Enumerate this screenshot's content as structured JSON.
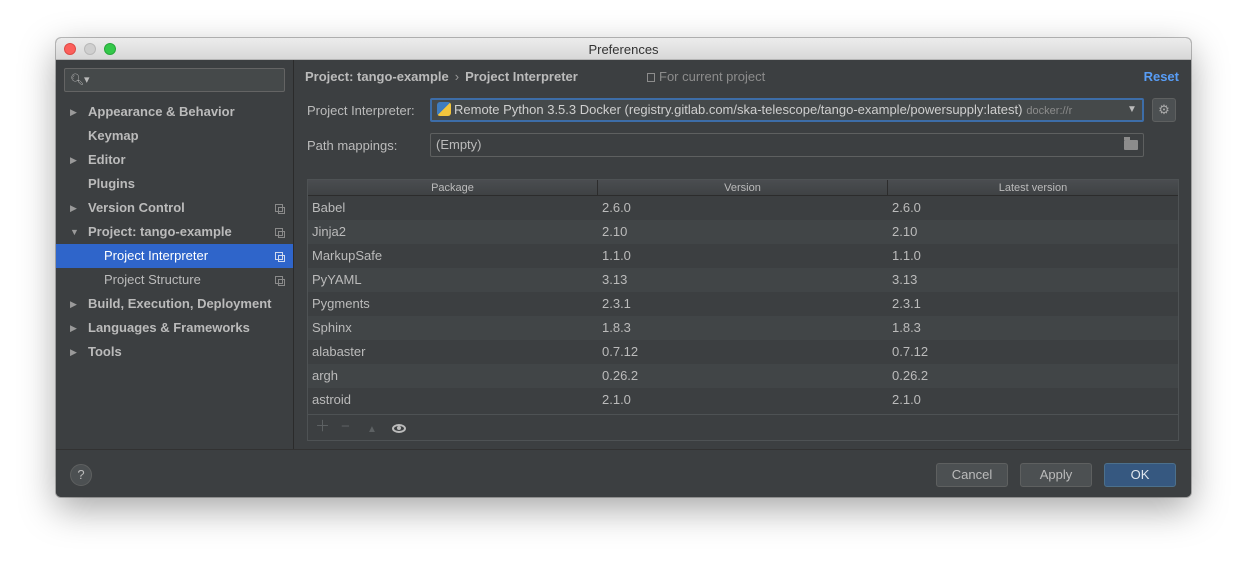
{
  "window": {
    "title": "Preferences"
  },
  "search": {
    "placeholder": ""
  },
  "sidebar": {
    "items": [
      {
        "label": "Appearance & Behavior",
        "expandable": true,
        "expanded": false
      },
      {
        "label": "Keymap",
        "expandable": false
      },
      {
        "label": "Editor",
        "expandable": true,
        "expanded": false
      },
      {
        "label": "Plugins",
        "expandable": false
      },
      {
        "label": "Version Control",
        "expandable": true,
        "expanded": false,
        "project_scoped": true
      },
      {
        "label": "Project: tango-example",
        "expandable": true,
        "expanded": true,
        "project_scoped": true
      },
      {
        "label": "Project Interpreter",
        "child": true,
        "selected": true,
        "project_scoped": true
      },
      {
        "label": "Project Structure",
        "child": true,
        "project_scoped": true
      },
      {
        "label": "Build, Execution, Deployment",
        "expandable": true,
        "expanded": false
      },
      {
        "label": "Languages & Frameworks",
        "expandable": true,
        "expanded": false
      },
      {
        "label": "Tools",
        "expandable": true,
        "expanded": false
      }
    ]
  },
  "header": {
    "crumb_parent": "Project: tango-example",
    "crumb_separator": "›",
    "crumb_current": "Project Interpreter",
    "scope_note": "For current project",
    "reset_label": "Reset"
  },
  "interpreter": {
    "label": "Project Interpreter:",
    "value": "Remote Python 3.5.3 Docker (registry.gitlab.com/ska-telescope/tango-example/powersupply:latest)",
    "hint": "docker://r"
  },
  "path_mappings": {
    "label": "Path mappings:",
    "value": "(Empty)"
  },
  "packages": {
    "columns": [
      "Package",
      "Version",
      "Latest version"
    ],
    "rows": [
      {
        "package": "Babel",
        "version": "2.6.0",
        "latest": "2.6.0"
      },
      {
        "package": "Jinja2",
        "version": "2.10",
        "latest": "2.10"
      },
      {
        "package": "MarkupSafe",
        "version": "1.1.0",
        "latest": "1.1.0"
      },
      {
        "package": "PyYAML",
        "version": "3.13",
        "latest": "3.13"
      },
      {
        "package": "Pygments",
        "version": "2.3.1",
        "latest": "2.3.1"
      },
      {
        "package": "Sphinx",
        "version": "1.8.3",
        "latest": "1.8.3"
      },
      {
        "package": "alabaster",
        "version": "0.7.12",
        "latest": "0.7.12"
      },
      {
        "package": "argh",
        "version": "0.26.2",
        "latest": "0.26.2"
      },
      {
        "package": "astroid",
        "version": "2.1.0",
        "latest": "2.1.0"
      }
    ]
  },
  "footer": {
    "help_label": "?",
    "cancel_label": "Cancel",
    "apply_label": "Apply",
    "ok_label": "OK"
  },
  "colors": {
    "selection": "#2f65ca",
    "link": "#589df6",
    "background": "#3c3f41",
    "ok_button": "#365880"
  }
}
